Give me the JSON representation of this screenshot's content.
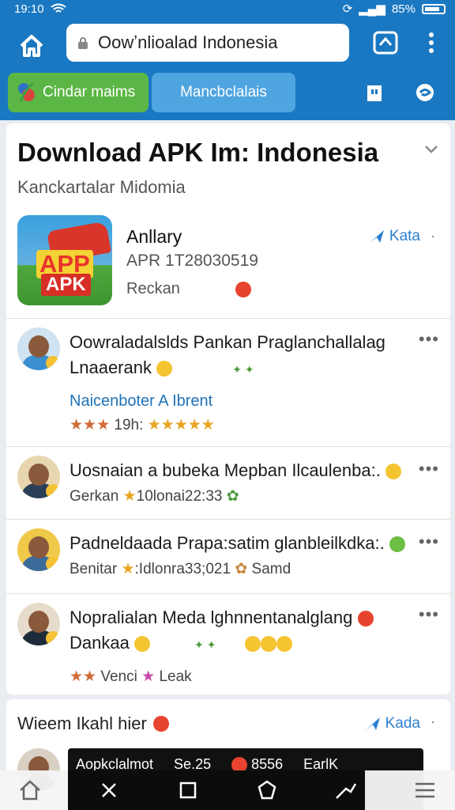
{
  "status": {
    "time": "19:10",
    "battery": "85%"
  },
  "browser": {
    "url": "Oowʼnlioalad Indonesia",
    "tabs": [
      {
        "label": "Cindar maims"
      },
      {
        "label": "Mancbclalais"
      }
    ]
  },
  "card": {
    "title": "Download APK Im: Indonesia",
    "subtitle": "Kanckartalar Midomia",
    "app": {
      "icon_top": "APP",
      "icon_bottom": "APK",
      "name": "Anllary",
      "version": "APR 1T28030519",
      "button": "Reckan",
      "action": "Kata"
    },
    "posts": [
      {
        "line1": "Oowraladalslds Pankan Praglanchallalag",
        "line2": "Lnaaerank",
        "link": "Naicenboter A Ibrent",
        "meta": "19h:",
        "stars_before": "★★★",
        "stars_after": "★★★★★"
      },
      {
        "line1": "Uosnaian a bubeka Mepban Ilcaulenba:.",
        "meta": "Gerkan",
        "meta2": "10lonai22:33"
      },
      {
        "line1": "Padneldaada Prapa:satim glanbleilkdka:.",
        "meta": "Benitar",
        "meta2": ":Idlonra33;021",
        "meta3": "Samd"
      },
      {
        "line1": "Nopralialan Meda lghnnentanalglang",
        "line2": "Dankaa",
        "meta": "Venci",
        "meta2": "Leak",
        "stars": "★★"
      }
    ]
  },
  "card2": {
    "title": "Wieem Ikahl hier",
    "action": "Kada"
  },
  "media": {
    "item1": "Aopkclalmot",
    "item2": "Se.25",
    "item3": "8556",
    "item4": "EarlK"
  },
  "colors": {
    "brand": "#1a78c2",
    "green_tab": "#5cb645",
    "link": "#1f73b8"
  },
  "icons": [
    "home-icon",
    "lock-icon",
    "tabs-icon",
    "menu-icon",
    "bookmark-icon",
    "chat-icon",
    "share-icon",
    "chevron-down-icon",
    "star-icon",
    "back-icon",
    "close-icon",
    "square-icon",
    "pentagon-icon",
    "hook-icon",
    "hamburger-icon"
  ]
}
